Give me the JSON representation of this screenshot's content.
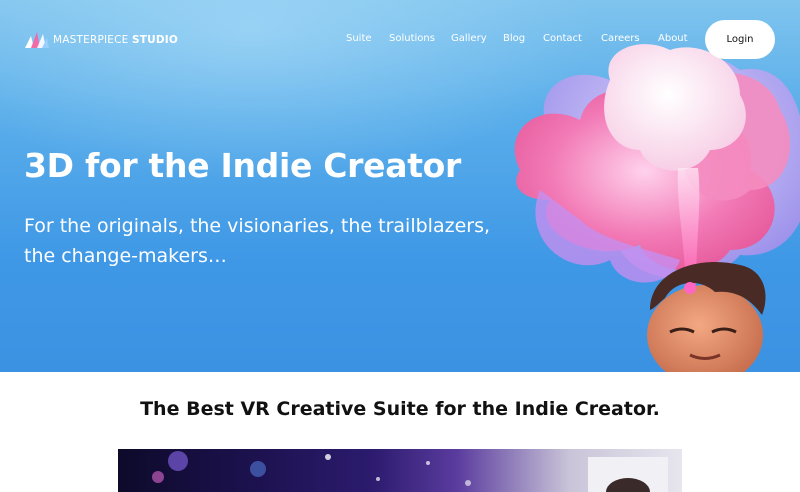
{
  "brand": {
    "name_thin": "MASTERPIECE ",
    "name_bold": "STUDIO"
  },
  "nav": {
    "items": [
      {
        "label": "Suite"
      },
      {
        "label": "Solutions"
      },
      {
        "label": "Gallery"
      },
      {
        "label": "Blog"
      },
      {
        "label": "Contact"
      },
      {
        "label": "Careers"
      },
      {
        "label": "About"
      }
    ],
    "login_label": "Login"
  },
  "hero": {
    "title": "3D for the Indie Creator",
    "subtitle_line1": "For the originals, the visionaries, the trailblazers,",
    "subtitle_line2": "the change-makers…"
  },
  "section": {
    "tagline_regular": "The Best VR Creative Suite ",
    "tagline_bold": "for the Indie Creator."
  },
  "colors": {
    "hero_top": "#7fc4ee",
    "hero_bottom": "#3c92e2",
    "text_on_hero": "#ffffff",
    "pink": "#f06aa8",
    "lilac": "#c9a3ee"
  },
  "icons": {
    "logo": "masterpiece-logo-icon",
    "illustration": "head-with-pink-thought-cloud-illustration"
  }
}
